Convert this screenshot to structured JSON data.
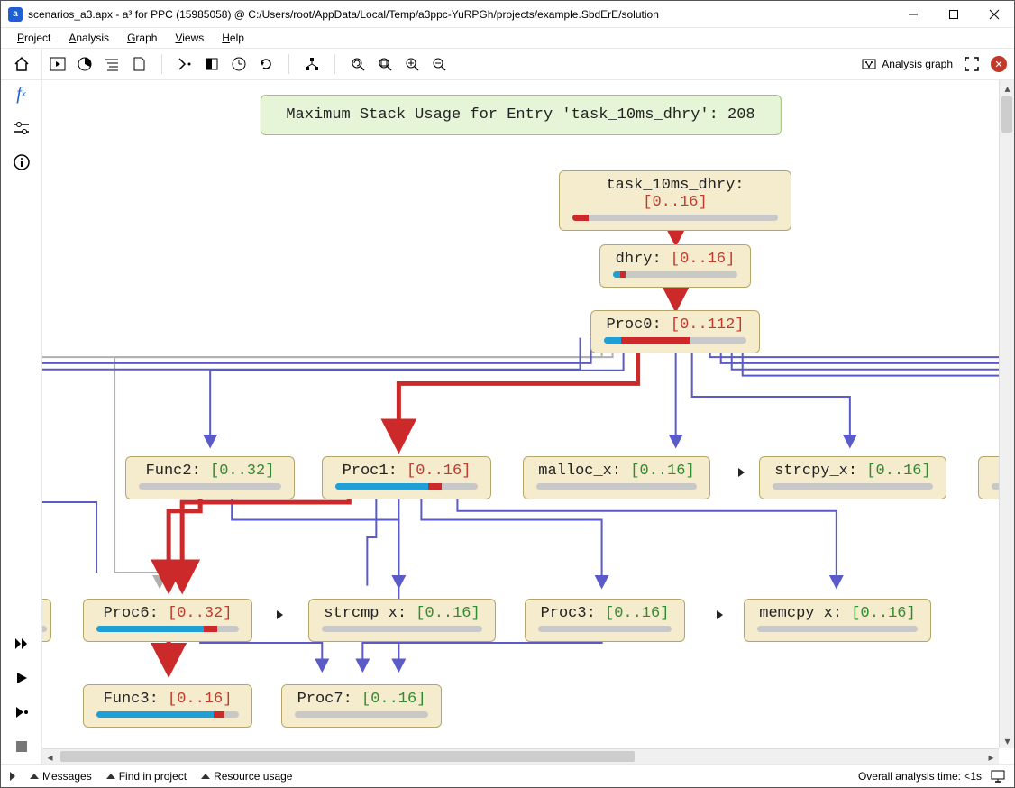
{
  "window": {
    "title": "scenarios_a3.apx - a³ for PPC (15985058) @ C:/Users/root/AppData/Local/Temp/a3ppc-YuRPGh/projects/example.SbdErE/solution"
  },
  "menu": {
    "items": [
      "Project",
      "Analysis",
      "Graph",
      "Views",
      "Help"
    ]
  },
  "toolbar_right": {
    "label": "Analysis graph"
  },
  "banner": {
    "text": "Maximum Stack Usage for Entry 'task_10ms_dhry': 208"
  },
  "nodes": {
    "task": {
      "name": "task_10ms_dhry:",
      "range": "[0..16]",
      "color": "red"
    },
    "dhry": {
      "name": "dhry:",
      "range": "[0..16]",
      "color": "red"
    },
    "proc0": {
      "name": "Proc0:",
      "range": "[0..112]",
      "color": "red"
    },
    "func2": {
      "name": "Func2:",
      "range": "[0..32]",
      "color": "green"
    },
    "proc1": {
      "name": "Proc1:",
      "range": "[0..16]",
      "color": "red"
    },
    "malloc": {
      "name": "malloc_x:",
      "range": "[0..16]",
      "color": "green"
    },
    "strcpy": {
      "name": "strcpy_x:",
      "range": "[0..16]",
      "color": "green"
    },
    "proc6": {
      "name": "Proc6:",
      "range": "[0..32]",
      "color": "red"
    },
    "strcmp": {
      "name": "strcmp_x:",
      "range": "[0..16]",
      "color": "green"
    },
    "proc3": {
      "name": "Proc3:",
      "range": "[0..16]",
      "color": "green"
    },
    "memcpy": {
      "name": "memcpy_x:",
      "range": "[0..16]",
      "color": "green"
    },
    "func3": {
      "name": "Func3:",
      "range": "[0..16]",
      "color": "red"
    },
    "proc7": {
      "name": "Proc7:",
      "range": "[0..16]",
      "color": "green"
    }
  },
  "status": {
    "messages": "Messages",
    "find": "Find in project",
    "resource": "Resource usage",
    "time": "Overall analysis time: <1s"
  }
}
